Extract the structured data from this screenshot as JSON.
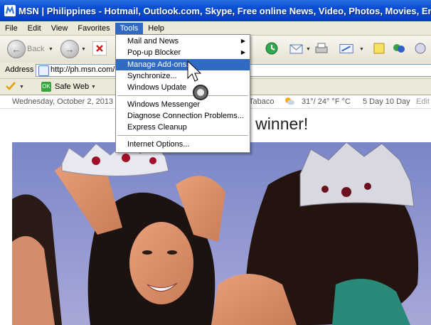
{
  "window": {
    "title": "MSN | Philippines - Hotmail, Outlook.com, Skype, Free online News, Video, Photos, Movies, Enter - Microsoft Internet Explorer"
  },
  "menubar": {
    "items": [
      {
        "label": "File"
      },
      {
        "label": "Edit"
      },
      {
        "label": "View"
      },
      {
        "label": "Favorites"
      },
      {
        "label": "Tools"
      },
      {
        "label": "Help"
      }
    ],
    "active": "Tools"
  },
  "toolbar": {
    "back_label": "Back"
  },
  "address": {
    "label": "Address",
    "url": "http://ph.msn.com/"
  },
  "links": {
    "safe_web_label": "Safe Web"
  },
  "tools_menu": {
    "items": [
      {
        "label": "Mail and News",
        "submenu": true
      },
      {
        "label": "Pop-up Blocker",
        "submenu": true
      },
      {
        "label": "Manage Add-ons...",
        "highlighted": true
      },
      {
        "label": "Synchronize..."
      },
      {
        "label": "Windows Update"
      },
      {
        "label": "Windows Messenger"
      },
      {
        "label": "Diagnose Connection Problems..."
      },
      {
        "label": "Express Cleanup"
      },
      {
        "label": "Internet Options..."
      }
    ]
  },
  "page": {
    "date": "Wednesday, October 2, 2013",
    "city": "Tabaco",
    "temperature": "31°/ 24° °F °C",
    "forecast": "5 Day 10 Day",
    "edit": "Edit",
    "headline": "d winner!"
  },
  "colors": {
    "title_bar": "#0a4fd4",
    "menu_highlight": "#316ac5",
    "safe_web_green": "#31a63a"
  }
}
